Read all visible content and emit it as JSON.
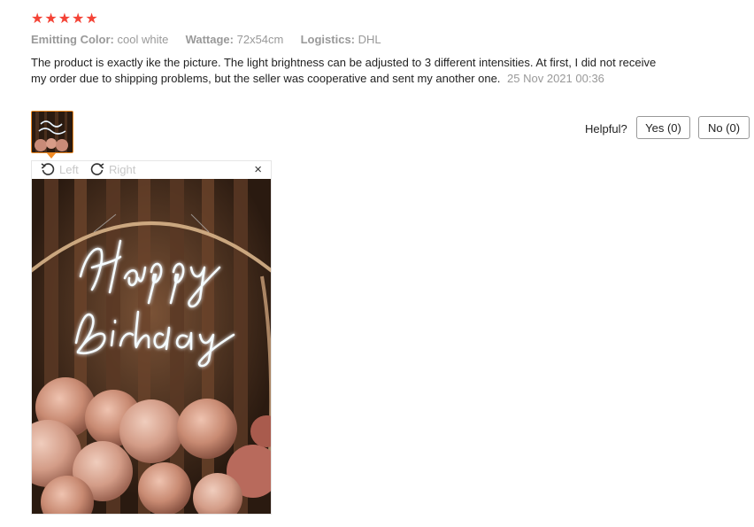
{
  "review": {
    "rating": 5,
    "attributes": [
      {
        "key": "Emitting Color:",
        "value": "cool white"
      },
      {
        "key": "Wattage:",
        "value": "72x54cm"
      },
      {
        "key": "Logistics:",
        "value": "DHL"
      }
    ],
    "text": "The product is exactly ike the picture. The light brightness can be adjusted to 3 different intensities. At first, I did not receive my order due to shipping problems, but the seller was cooperative and sent my another one.",
    "date": "25 Nov 2021 00:36"
  },
  "helpful": {
    "label": "Helpful?",
    "yes_label": "Yes (0)",
    "no_label": "No (0)"
  },
  "viewer": {
    "rotate_left_label": "Left",
    "rotate_right_label": "Right",
    "close_glyph": "×",
    "sign_line1": "Happy",
    "sign_line2": "Birthday"
  },
  "colors": {
    "star": "#f44336",
    "thumb_border": "#f08a24",
    "muted_text": "#999999"
  }
}
